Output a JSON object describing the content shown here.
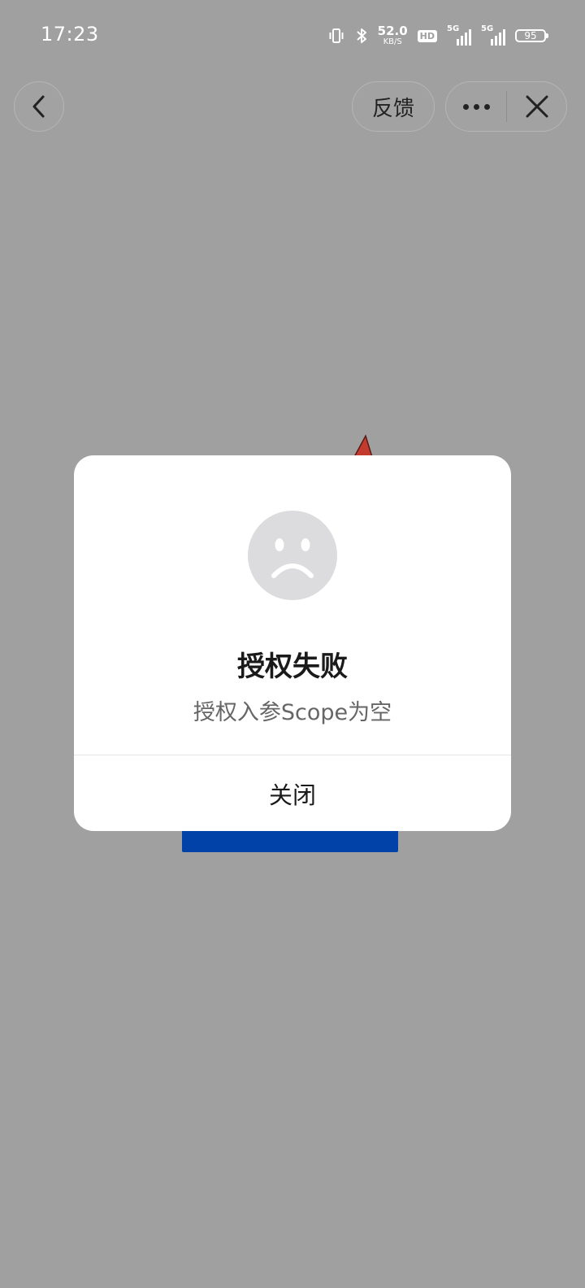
{
  "status_bar": {
    "time": "17:23",
    "net_speed_value": "52.0",
    "net_speed_unit": "KB/S",
    "hd_label": "HD",
    "sim1_label": "5G",
    "sim2_label": "5G",
    "battery": "95",
    "icons": [
      "vibrate-icon",
      "bluetooth-icon",
      "hd-icon",
      "signal-icon",
      "signal-icon",
      "battery-icon"
    ]
  },
  "nav": {
    "back_icon": "chevron-left-icon",
    "feedback_label": "反馈",
    "more_icon": "more-dots-icon",
    "close_icon": "close-icon"
  },
  "dialog": {
    "icon": "sad-face-icon",
    "title": "授权失败",
    "message": "授权入参Scope为空",
    "close_label": "关闭"
  },
  "colors": {
    "overlay": "#a0a0a0",
    "dialog_bg": "#ffffff",
    "background_button": "#0042a8",
    "face": "#dcdcde"
  }
}
